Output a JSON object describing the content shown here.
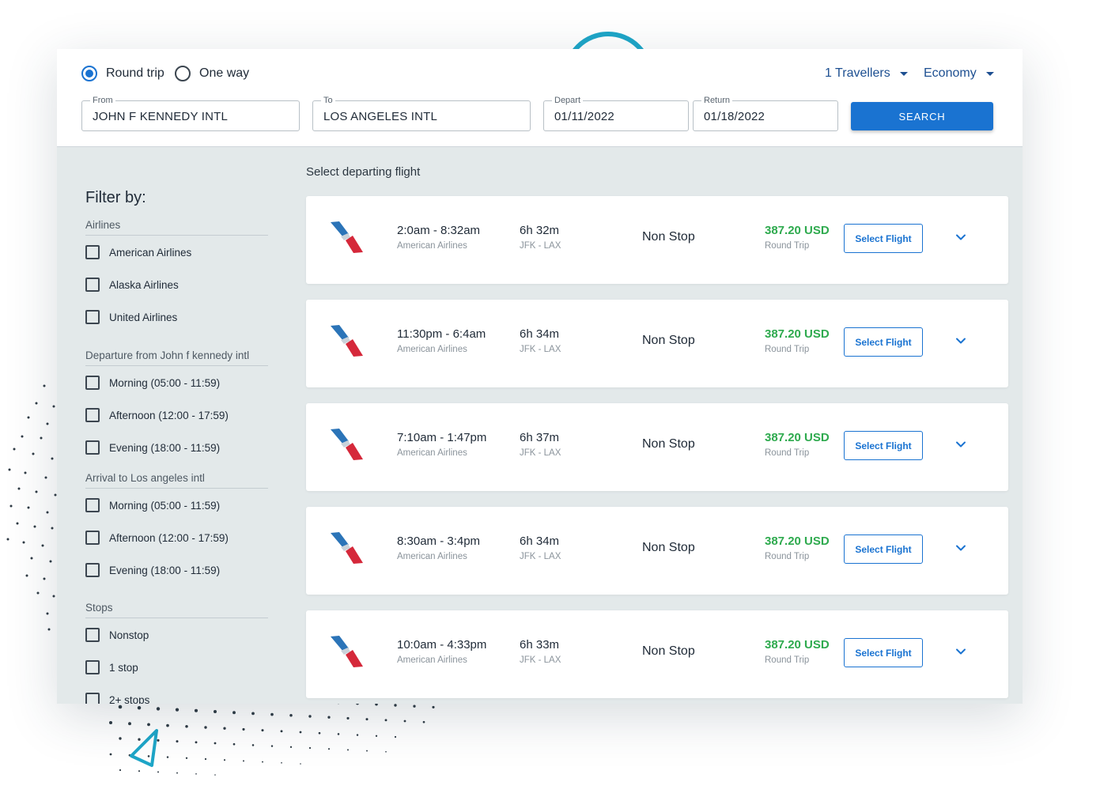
{
  "trip_type": {
    "options": [
      "Round trip",
      "One way"
    ],
    "selected": "Round trip"
  },
  "travellers": {
    "label": "1 Travellers"
  },
  "cabin_class": {
    "label": "Economy"
  },
  "search": {
    "from": {
      "label": "From",
      "value": "JOHN F KENNEDY INTL"
    },
    "to": {
      "label": "To",
      "value": "LOS ANGELES INTL"
    },
    "depart": {
      "label": "Depart",
      "value": "01/11/2022"
    },
    "return": {
      "label": "Return",
      "value": "01/18/2022"
    },
    "button_label": "SEARCH"
  },
  "filters": {
    "title": "Filter by:",
    "airlines": {
      "heading": "Airlines",
      "options": [
        "American Airlines",
        "Alaska Airlines",
        "United Airlines"
      ]
    },
    "departure": {
      "heading": "Departure from John f kennedy intl",
      "options": [
        "Morning (05:00 - 11:59)",
        "Afternoon (12:00 - 17:59)",
        "Evening (18:00 - 11:59)"
      ]
    },
    "arrival": {
      "heading": "Arrival to Los angeles intl",
      "options": [
        "Morning (05:00 - 11:59)",
        "Afternoon (12:00 - 17:59)",
        "Evening (18:00 - 11:59)"
      ]
    },
    "stops": {
      "heading": "Stops",
      "options": [
        "Nonstop",
        "1 stop",
        "2+ stops"
      ]
    }
  },
  "results": {
    "heading": "Select departing flight",
    "select_label": "Select Flight",
    "flights": [
      {
        "times": "2:0am - 8:32am",
        "airline": "American Airlines",
        "duration": "6h 32m",
        "route": "JFK - LAX",
        "stops": "Non Stop",
        "price": "387.20 USD",
        "fare": "Round Trip"
      },
      {
        "times": "11:30pm - 6:4am",
        "airline": "American Airlines",
        "duration": "6h 34m",
        "route": "JFK - LAX",
        "stops": "Non Stop",
        "price": "387.20 USD",
        "fare": "Round Trip"
      },
      {
        "times": "7:10am - 1:47pm",
        "airline": "American Airlines",
        "duration": "6h 37m",
        "route": "JFK - LAX",
        "stops": "Non Stop",
        "price": "387.20 USD",
        "fare": "Round Trip"
      },
      {
        "times": "8:30am - 3:4pm",
        "airline": "American Airlines",
        "duration": "6h 34m",
        "route": "JFK - LAX",
        "stops": "Non Stop",
        "price": "387.20 USD",
        "fare": "Round Trip"
      },
      {
        "times": "10:0am - 4:33pm",
        "airline": "American Airlines",
        "duration": "6h 33m",
        "route": "JFK - LAX",
        "stops": "Non Stop",
        "price": "387.20 USD",
        "fare": "Round Trip"
      }
    ]
  },
  "icons": {
    "airline_logo": "american-airlines-logo-icon",
    "expand": "chevron-down-icon",
    "deco_plane": "paper-plane-icon"
  },
  "colors": {
    "accent": "#1a73d1",
    "price": "#2eaa4e",
    "dropdown_text": "#1d4f91",
    "panel_bg": "#e3e9ea"
  }
}
